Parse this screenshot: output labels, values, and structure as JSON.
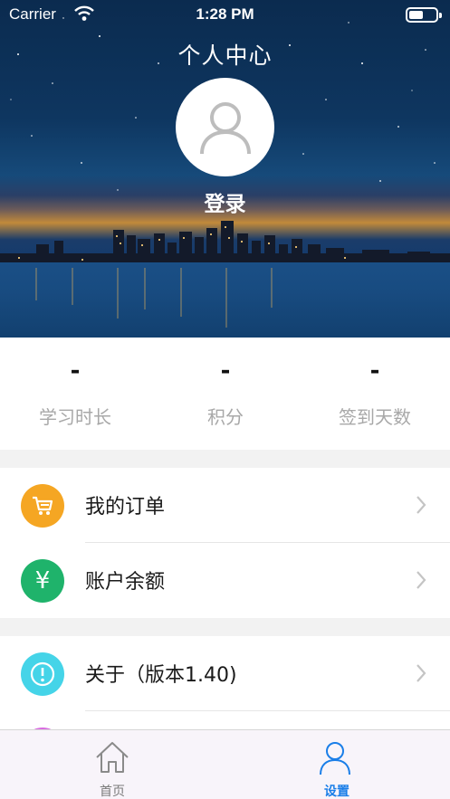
{
  "status_bar": {
    "carrier": "Carrier",
    "time": "1:28 PM",
    "battery_level": 0.55
  },
  "header": {
    "title": "个人中心",
    "login_label": "登录"
  },
  "stats": [
    {
      "value": "-",
      "label": "学习时长"
    },
    {
      "value": "-",
      "label": "积分"
    },
    {
      "value": "-",
      "label": "签到天数"
    }
  ],
  "menu": {
    "orders": {
      "label": "我的订单",
      "icon": "cart-icon",
      "color": "#f5a623"
    },
    "balance": {
      "label": "账户余额",
      "icon": "yen-icon",
      "color": "#1fb36b",
      "glyph": "¥"
    },
    "about": {
      "label": "关于（版本1.40)",
      "icon": "info-icon",
      "color": "#45d4e8"
    }
  },
  "tabbar": {
    "home": {
      "label": "首页",
      "icon": "home-icon"
    },
    "settings": {
      "label": "设置",
      "icon": "person-icon",
      "active_color": "#1a7ee8"
    }
  }
}
